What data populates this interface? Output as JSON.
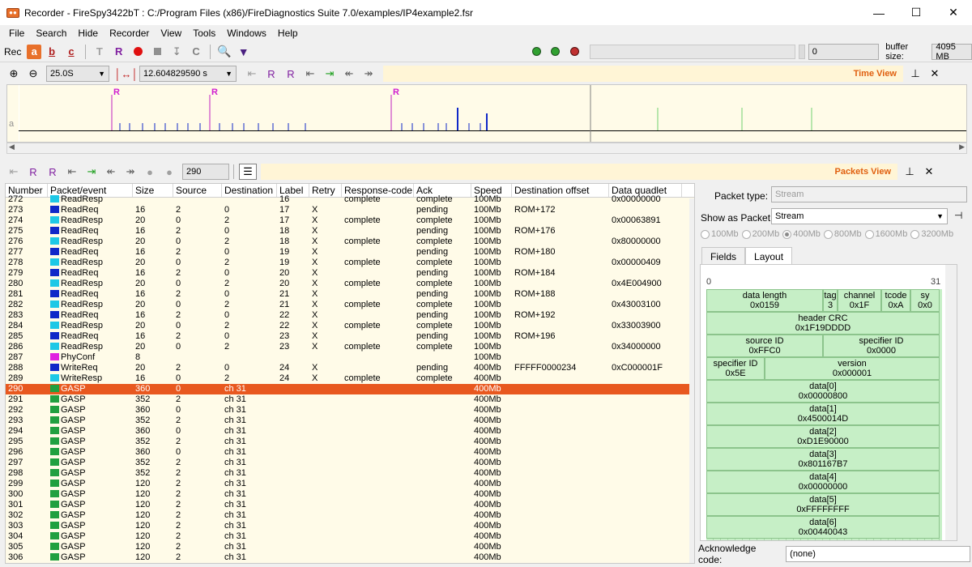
{
  "window": {
    "title": "Recorder - FireSpy3422bT : C:/Program Files (x86)/FireDiagnostics Suite 7.0/examples/IP4example2.fsr"
  },
  "menu": [
    "File",
    "Search",
    "Hide",
    "Recorder",
    "View",
    "Tools",
    "Windows",
    "Help"
  ],
  "toolbar": {
    "rec_label": "Rec",
    "btn_a": "a",
    "btn_b": "b",
    "btn_c": "c",
    "counter": "0",
    "buffer_label": "buffer size:",
    "buffer_value": "4095 MB"
  },
  "timeview": {
    "zoom": "25.0S",
    "time": "12.604829590 s",
    "title": "Time View",
    "row_label": "a",
    "marker": "R"
  },
  "packets": {
    "title": "Packets View",
    "goto_value": "290"
  },
  "table": {
    "headers": [
      "Number",
      "Packet/event",
      "Size",
      "Source",
      "Destination",
      "Label",
      "Retry",
      "Response-code",
      "Ack",
      "Speed",
      "Destination offset",
      "Data quadlet"
    ],
    "rows": [
      {
        "n": "272",
        "t": "ReadResp",
        "c": "#1ec8e6",
        "size": "",
        "src": "",
        "dst": "",
        "lbl": "16",
        "retry": "",
        "rc": "complete",
        "ack": "complete",
        "spd": "100Mb",
        "off": "",
        "dq": "0x00000000"
      },
      {
        "n": "273",
        "t": "ReadReq",
        "c": "#1028c8",
        "size": "16",
        "src": "2",
        "dst": "0",
        "lbl": "17",
        "retry": "X",
        "rc": "",
        "ack": "pending",
        "spd": "100Mb",
        "off": "ROM+172",
        "dq": ""
      },
      {
        "n": "274",
        "t": "ReadResp",
        "c": "#1ec8e6",
        "size": "20",
        "src": "0",
        "dst": "2",
        "lbl": "17",
        "retry": "X",
        "rc": "complete",
        "ack": "complete",
        "spd": "100Mb",
        "off": "",
        "dq": "0x00063891"
      },
      {
        "n": "275",
        "t": "ReadReq",
        "c": "#1028c8",
        "size": "16",
        "src": "2",
        "dst": "0",
        "lbl": "18",
        "retry": "X",
        "rc": "",
        "ack": "pending",
        "spd": "100Mb",
        "off": "ROM+176",
        "dq": ""
      },
      {
        "n": "276",
        "t": "ReadResp",
        "c": "#1ec8e6",
        "size": "20",
        "src": "0",
        "dst": "2",
        "lbl": "18",
        "retry": "X",
        "rc": "complete",
        "ack": "complete",
        "spd": "100Mb",
        "off": "",
        "dq": "0x80000000"
      },
      {
        "n": "277",
        "t": "ReadReq",
        "c": "#1028c8",
        "size": "16",
        "src": "2",
        "dst": "0",
        "lbl": "19",
        "retry": "X",
        "rc": "",
        "ack": "pending",
        "spd": "100Mb",
        "off": "ROM+180",
        "dq": ""
      },
      {
        "n": "278",
        "t": "ReadResp",
        "c": "#1ec8e6",
        "size": "20",
        "src": "0",
        "dst": "2",
        "lbl": "19",
        "retry": "X",
        "rc": "complete",
        "ack": "complete",
        "spd": "100Mb",
        "off": "",
        "dq": "0x00000409"
      },
      {
        "n": "279",
        "t": "ReadReq",
        "c": "#1028c8",
        "size": "16",
        "src": "2",
        "dst": "0",
        "lbl": "20",
        "retry": "X",
        "rc": "",
        "ack": "pending",
        "spd": "100Mb",
        "off": "ROM+184",
        "dq": ""
      },
      {
        "n": "280",
        "t": "ReadResp",
        "c": "#1ec8e6",
        "size": "20",
        "src": "0",
        "dst": "2",
        "lbl": "20",
        "retry": "X",
        "rc": "complete",
        "ack": "complete",
        "spd": "100Mb",
        "off": "",
        "dq": "0x4E004900"
      },
      {
        "n": "281",
        "t": "ReadReq",
        "c": "#1028c8",
        "size": "16",
        "src": "2",
        "dst": "0",
        "lbl": "21",
        "retry": "X",
        "rc": "",
        "ack": "pending",
        "spd": "100Mb",
        "off": "ROM+188",
        "dq": ""
      },
      {
        "n": "282",
        "t": "ReadResp",
        "c": "#1ec8e6",
        "size": "20",
        "src": "0",
        "dst": "2",
        "lbl": "21",
        "retry": "X",
        "rc": "complete",
        "ack": "complete",
        "spd": "100Mb",
        "off": "",
        "dq": "0x43003100"
      },
      {
        "n": "283",
        "t": "ReadReq",
        "c": "#1028c8",
        "size": "16",
        "src": "2",
        "dst": "0",
        "lbl": "22",
        "retry": "X",
        "rc": "",
        "ack": "pending",
        "spd": "100Mb",
        "off": "ROM+192",
        "dq": ""
      },
      {
        "n": "284",
        "t": "ReadResp",
        "c": "#1ec8e6",
        "size": "20",
        "src": "0",
        "dst": "2",
        "lbl": "22",
        "retry": "X",
        "rc": "complete",
        "ack": "complete",
        "spd": "100Mb",
        "off": "",
        "dq": "0x33003900"
      },
      {
        "n": "285",
        "t": "ReadReq",
        "c": "#1028c8",
        "size": "16",
        "src": "2",
        "dst": "0",
        "lbl": "23",
        "retry": "X",
        "rc": "",
        "ack": "pending",
        "spd": "100Mb",
        "off": "ROM+196",
        "dq": ""
      },
      {
        "n": "286",
        "t": "ReadResp",
        "c": "#1ec8e6",
        "size": "20",
        "src": "0",
        "dst": "2",
        "lbl": "23",
        "retry": "X",
        "rc": "complete",
        "ack": "complete",
        "spd": "100Mb",
        "off": "",
        "dq": "0x34000000"
      },
      {
        "n": "287",
        "t": "PhyConf",
        "c": "#e020e0",
        "size": "8",
        "src": "",
        "dst": "",
        "lbl": "",
        "retry": "",
        "rc": "",
        "ack": "",
        "spd": "100Mb",
        "off": "",
        "dq": ""
      },
      {
        "n": "288",
        "t": "WriteReq",
        "c": "#1028c8",
        "size": "20",
        "src": "2",
        "dst": "0",
        "lbl": "24",
        "retry": "X",
        "rc": "",
        "ack": "pending",
        "spd": "400Mb",
        "off": "FFFFF0000234",
        "dq": "0xC000001F"
      },
      {
        "n": "289",
        "t": "WriteResp",
        "c": "#1ec8e6",
        "size": "16",
        "src": "0",
        "dst": "2",
        "lbl": "24",
        "retry": "X",
        "rc": "complete",
        "ack": "complete",
        "spd": "400Mb",
        "off": "",
        "dq": ""
      },
      {
        "n": "290",
        "t": "GASP",
        "c": "#20a040",
        "size": "360",
        "src": "0",
        "dst": "ch 31",
        "lbl": "",
        "retry": "",
        "rc": "",
        "ack": "",
        "spd": "400Mb",
        "off": "",
        "dq": "",
        "sel": true
      },
      {
        "n": "291",
        "t": "GASP",
        "c": "#20a040",
        "size": "352",
        "src": "2",
        "dst": "ch 31",
        "lbl": "",
        "retry": "",
        "rc": "",
        "ack": "",
        "spd": "400Mb",
        "off": "",
        "dq": ""
      },
      {
        "n": "292",
        "t": "GASP",
        "c": "#20a040",
        "size": "360",
        "src": "0",
        "dst": "ch 31",
        "lbl": "",
        "retry": "",
        "rc": "",
        "ack": "",
        "spd": "400Mb",
        "off": "",
        "dq": ""
      },
      {
        "n": "293",
        "t": "GASP",
        "c": "#20a040",
        "size": "352",
        "src": "2",
        "dst": "ch 31",
        "lbl": "",
        "retry": "",
        "rc": "",
        "ack": "",
        "spd": "400Mb",
        "off": "",
        "dq": ""
      },
      {
        "n": "294",
        "t": "GASP",
        "c": "#20a040",
        "size": "360",
        "src": "0",
        "dst": "ch 31",
        "lbl": "",
        "retry": "",
        "rc": "",
        "ack": "",
        "spd": "400Mb",
        "off": "",
        "dq": ""
      },
      {
        "n": "295",
        "t": "GASP",
        "c": "#20a040",
        "size": "352",
        "src": "2",
        "dst": "ch 31",
        "lbl": "",
        "retry": "",
        "rc": "",
        "ack": "",
        "spd": "400Mb",
        "off": "",
        "dq": ""
      },
      {
        "n": "296",
        "t": "GASP",
        "c": "#20a040",
        "size": "360",
        "src": "0",
        "dst": "ch 31",
        "lbl": "",
        "retry": "",
        "rc": "",
        "ack": "",
        "spd": "400Mb",
        "off": "",
        "dq": ""
      },
      {
        "n": "297",
        "t": "GASP",
        "c": "#20a040",
        "size": "352",
        "src": "2",
        "dst": "ch 31",
        "lbl": "",
        "retry": "",
        "rc": "",
        "ack": "",
        "spd": "400Mb",
        "off": "",
        "dq": ""
      },
      {
        "n": "298",
        "t": "GASP",
        "c": "#20a040",
        "size": "352",
        "src": "2",
        "dst": "ch 31",
        "lbl": "",
        "retry": "",
        "rc": "",
        "ack": "",
        "spd": "400Mb",
        "off": "",
        "dq": ""
      },
      {
        "n": "299",
        "t": "GASP",
        "c": "#20a040",
        "size": "120",
        "src": "2",
        "dst": "ch 31",
        "lbl": "",
        "retry": "",
        "rc": "",
        "ack": "",
        "spd": "400Mb",
        "off": "",
        "dq": ""
      },
      {
        "n": "300",
        "t": "GASP",
        "c": "#20a040",
        "size": "120",
        "src": "2",
        "dst": "ch 31",
        "lbl": "",
        "retry": "",
        "rc": "",
        "ack": "",
        "spd": "400Mb",
        "off": "",
        "dq": ""
      },
      {
        "n": "301",
        "t": "GASP",
        "c": "#20a040",
        "size": "120",
        "src": "2",
        "dst": "ch 31",
        "lbl": "",
        "retry": "",
        "rc": "",
        "ack": "",
        "spd": "400Mb",
        "off": "",
        "dq": ""
      },
      {
        "n": "302",
        "t": "GASP",
        "c": "#20a040",
        "size": "120",
        "src": "2",
        "dst": "ch 31",
        "lbl": "",
        "retry": "",
        "rc": "",
        "ack": "",
        "spd": "400Mb",
        "off": "",
        "dq": ""
      },
      {
        "n": "303",
        "t": "GASP",
        "c": "#20a040",
        "size": "120",
        "src": "2",
        "dst": "ch 31",
        "lbl": "",
        "retry": "",
        "rc": "",
        "ack": "",
        "spd": "400Mb",
        "off": "",
        "dq": ""
      },
      {
        "n": "304",
        "t": "GASP",
        "c": "#20a040",
        "size": "120",
        "src": "2",
        "dst": "ch 31",
        "lbl": "",
        "retry": "",
        "rc": "",
        "ack": "",
        "spd": "400Mb",
        "off": "",
        "dq": ""
      },
      {
        "n": "305",
        "t": "GASP",
        "c": "#20a040",
        "size": "120",
        "src": "2",
        "dst": "ch 31",
        "lbl": "",
        "retry": "",
        "rc": "",
        "ack": "",
        "spd": "400Mb",
        "off": "",
        "dq": ""
      },
      {
        "n": "306",
        "t": "GASP",
        "c": "#20a040",
        "size": "120",
        "src": "2",
        "dst": "ch 31",
        "lbl": "",
        "retry": "",
        "rc": "",
        "ack": "",
        "spd": "400Mb",
        "off": "",
        "dq": ""
      }
    ]
  },
  "details": {
    "packet_type_label": "Packet type:",
    "packet_type_value": "Stream",
    "show_as_label": "Show as Packet:",
    "show_as_value": "Stream",
    "speeds": [
      "100Mb",
      "200Mb",
      "400Mb",
      "800Mb",
      "1600Mb",
      "3200Mb"
    ],
    "selected_speed": "400Mb",
    "tabs": [
      "Fields",
      "Layout"
    ],
    "bit_start": "0",
    "bit_end": "31",
    "fields": {
      "data_length": [
        "data length",
        "0x0159"
      ],
      "tag": [
        "tag",
        "3"
      ],
      "channel": [
        "channel",
        "0x1F"
      ],
      "tcode": [
        "tcode",
        "0xA"
      ],
      "sy": [
        "sy",
        "0x0"
      ],
      "header_crc": [
        "header CRC",
        "0x1F19DDDD"
      ],
      "source_id": [
        "source ID",
        "0xFFC0"
      ],
      "specifier_id_a": [
        "specifier ID",
        "0x0000"
      ],
      "specifier_id_b": [
        "specifier ID",
        "0x5E"
      ],
      "version": [
        "version",
        "0x000001"
      ],
      "data0": [
        "data[0]",
        "0x00000800"
      ],
      "data1": [
        "data[1]",
        "0x4500014D"
      ],
      "data2": [
        "data[2]",
        "0xD1E90000"
      ],
      "data3": [
        "data[3]",
        "0x801167B7"
      ],
      "data4": [
        "data[4]",
        "0x00000000"
      ],
      "data5": [
        "data[5]",
        "0xFFFFFFFF"
      ],
      "data6": [
        "data[6]",
        "0x00440043"
      ]
    },
    "ack_label": "Acknowledge code:",
    "ack_value": "(none)"
  }
}
